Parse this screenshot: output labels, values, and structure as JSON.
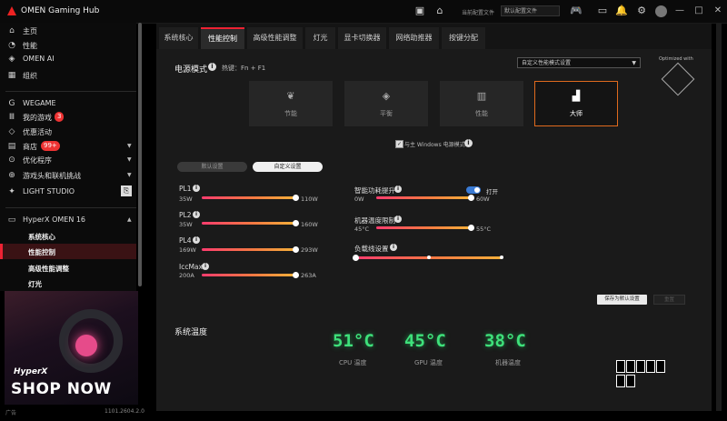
{
  "app": {
    "title": "OMEN Gaming Hub"
  },
  "titlebar": {
    "profile_label": "当前配置文件",
    "profile_value": "默认配置文件"
  },
  "sidebar": {
    "items": [
      {
        "label": "主页",
        "icon": "home-icon"
      },
      {
        "label": "性能",
        "icon": "gauge-icon"
      },
      {
        "label": "OMEN AI",
        "icon": "diamond-icon"
      },
      {
        "label": "组织",
        "icon": "grid-icon"
      },
      {
        "label": "WEGAME",
        "icon": "wegame-icon"
      },
      {
        "label": "我的游戏",
        "icon": "library-icon",
        "badge": "3"
      },
      {
        "label": "优惠活动",
        "icon": "tag-icon"
      },
      {
        "label": "商店",
        "icon": "store-icon",
        "badge": "99+"
      },
      {
        "label": "优化程序",
        "icon": "optimize-icon"
      },
      {
        "label": "游戏头和联机挑战",
        "icon": "controller-icon"
      },
      {
        "label": "LIGHT STUDIO",
        "icon": "light-icon"
      }
    ],
    "device": "HyperX OMEN 16",
    "sub_items": [
      "系统核心",
      "性能控制",
      "高级性能调整",
      "灯光"
    ]
  },
  "ad": {
    "brand": "HyperX",
    "cta": "SHOP NOW",
    "label": "广告"
  },
  "version": "1101.2604.2.0",
  "tabs": [
    "系统核心",
    "性能控制",
    "高级性能调整",
    "灯光",
    "显卡切换器",
    "网络助推器",
    "按键分配"
  ],
  "power": {
    "title": "电源模式",
    "hotkey": "热键：Fn + F1",
    "dropdown": "自定义性能模式设置",
    "optimized_with": "Optimized with",
    "modes": [
      {
        "label": "节能",
        "icon": "leaf-icon"
      },
      {
        "label": "平衡",
        "icon": "balance-icon"
      },
      {
        "label": "性能",
        "icon": "performance-icon"
      },
      {
        "label": "大师",
        "icon": "master-icon"
      }
    ],
    "windows_sync": "与主 Windows 电源模式"
  },
  "segments": {
    "default": "默认设置",
    "custom": "自定义设置"
  },
  "sliders": [
    {
      "label": "PL1",
      "min": "35W",
      "max": "110W",
      "value_fraction": 1.0
    },
    {
      "label": "PL2",
      "min": "35W",
      "max": "160W",
      "value_fraction": 1.0
    },
    {
      "label": "PL4",
      "min": "169W",
      "max": "293W",
      "value_fraction": 1.0
    },
    {
      "label": "IccMax",
      "min": "200A",
      "max": "263A",
      "value_fraction": 1.0
    },
    {
      "label": "智能功耗提升",
      "min": "0W",
      "max": "60W",
      "value_fraction": 1.0,
      "toggle": "打开"
    },
    {
      "label": "机器温度限制",
      "min": "45°C",
      "max": "55°C",
      "value_fraction": 1.0
    },
    {
      "label": "负载线设置",
      "min": "",
      "max": "",
      "value_fraction": 0.0
    }
  ],
  "buttons": {
    "save": "保存为默认设置",
    "reset": "重置"
  },
  "temps": {
    "title": "系统温度",
    "items": [
      {
        "value": "51°C",
        "label": "CPU 温度"
      },
      {
        "value": "45°C",
        "label": "GPU 温度"
      },
      {
        "value": "38°C",
        "label": "机器温度"
      }
    ]
  },
  "colors": {
    "accent": "#e22233",
    "temp": "#3ee07a",
    "mode_active_border": "#e06a1e"
  }
}
